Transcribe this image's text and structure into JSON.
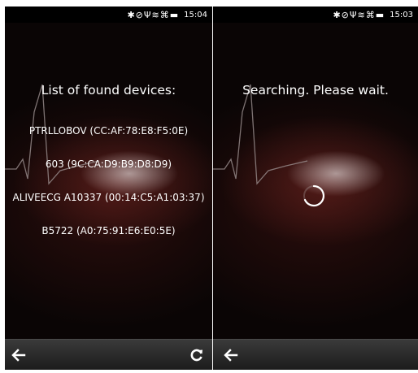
{
  "left_screen": {
    "status": {
      "time": "15:04",
      "icons": "✱⊘Ψ≋⌘▬"
    },
    "title": "List of found devices:",
    "devices": [
      "PTRLLOBOV (CC:AF:78:E8:F5:0E)",
      "603 (9C:CA:D9:B9:D8:D9)",
      "ALIVEECG A10337 (00:14:C5:A1:03:37)",
      "B5722 (A0:75:91:E6:E0:5E)"
    ],
    "toolbar": {
      "back_icon": "back-arrow-icon",
      "refresh_icon": "refresh-icon"
    }
  },
  "right_screen": {
    "status": {
      "time": "15:03",
      "icons": "✱⊘Ψ≋⌘▬"
    },
    "message": "Searching. Please wait.",
    "toolbar": {
      "back_icon": "back-arrow-icon"
    }
  },
  "colors": {
    "text": "#ffffff",
    "toolbar": "#2a2a2a",
    "background": "#0b0606"
  }
}
